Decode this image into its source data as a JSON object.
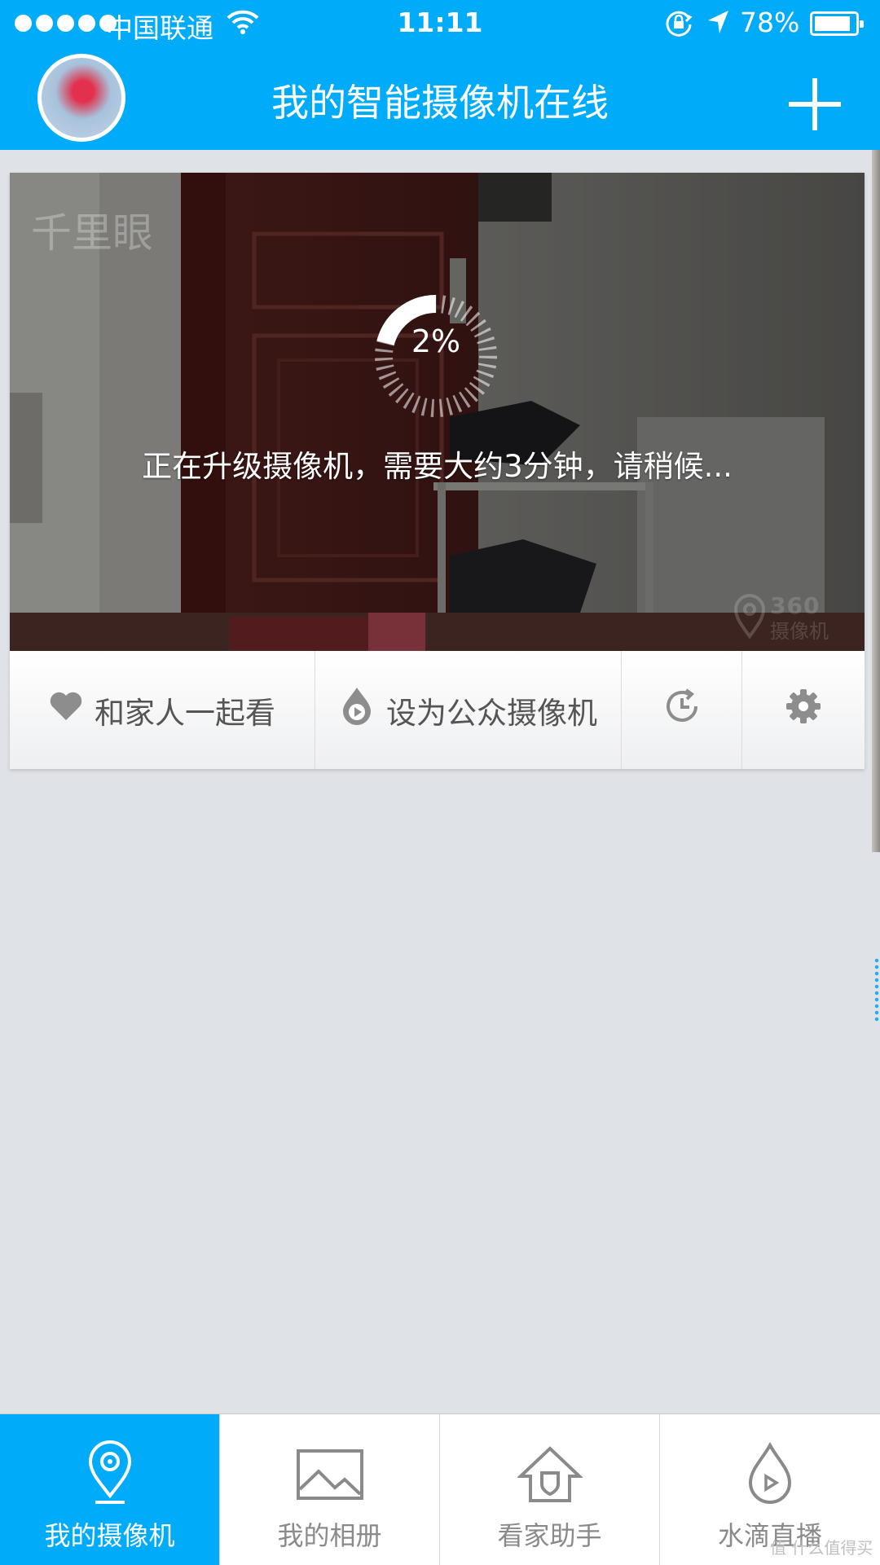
{
  "status_bar": {
    "carrier": "中国联通",
    "time": "11:11",
    "battery_percent": "78%",
    "battery_level": 0.78,
    "icons": [
      "signal-dots-icon",
      "wifi-icon",
      "rotation-lock-icon",
      "location-arrow-icon",
      "battery-icon"
    ]
  },
  "header": {
    "title": "我的智能摄像机在线",
    "avatar": "user-avatar",
    "add_icon": "plus-icon"
  },
  "camera_card": {
    "camera_name": "千里眼",
    "progress_text": "2%",
    "progress_value": 0.02,
    "upgrade_message": "正在升级摄像机，需要大约3分钟，请稍候...",
    "watermark_brand": "360",
    "watermark_text": "摄像机",
    "actions": [
      {
        "label": "和家人一起看",
        "icon": "heart-icon"
      },
      {
        "label": "设为公众摄像机",
        "icon": "water-drop-play-icon"
      },
      {
        "label": "",
        "icon": "history-clock-icon"
      },
      {
        "label": "",
        "icon": "gear-icon"
      }
    ]
  },
  "tabs": [
    {
      "label": "我的摄像机",
      "icon": "location-pin-icon",
      "active": true
    },
    {
      "label": "我的相册",
      "icon": "picture-icon",
      "active": false
    },
    {
      "label": "看家助手",
      "icon": "home-shield-icon",
      "active": false
    },
    {
      "label": "水滴直播",
      "icon": "water-drop-play-icon",
      "active": false
    }
  ],
  "site_watermark": "值 什么值得买",
  "colors": {
    "brand_blue": "#00abfa",
    "background": "#dfe2e7",
    "inactive_text": "#8a8a8a"
  }
}
